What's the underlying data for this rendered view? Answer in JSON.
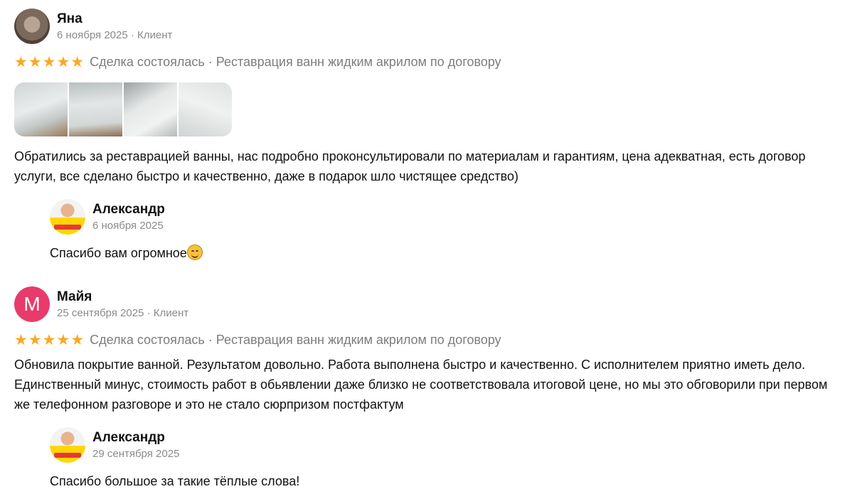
{
  "reviews": [
    {
      "author": "Яна",
      "date": "6 ноября 2025",
      "role": "Клиент",
      "rating": 5,
      "deal": "Сделка состоялась · Реставрация ванн жидким акрилом по договору",
      "photos": [
        "bathtub-photo-1",
        "bathtub-photo-2",
        "bathtub-photo-3",
        "bathtub-photo-4"
      ],
      "text": "Обратились за реставрацией ванны, нас подробно проконсультировали по материалам и гарантиям, цена адекватная, есть договор услуги, все сделано быстро и качественно, даже в подарок шло чистящее средство)",
      "reply": {
        "author": "Александр",
        "date": "6 ноября 2025",
        "text": "Спасибо вам огромное",
        "emoji": "smiling-face-emoji"
      }
    },
    {
      "author": "Майя",
      "avatar_letter": "М",
      "avatar_color": "#e83a6b",
      "date": "25 сентября 2025",
      "role": "Клиент",
      "rating": 5,
      "deal": "Сделка состоялась · Реставрация ванн жидким акрилом по договору",
      "text": "Обновила покрытие ванной. Результатом довольно. Работа выполнена быстро и качественно. С исполнителем приятно иметь дело. Единственный минус, стоимость работ в обьявлении даже близко не соответствовала итоговой цене, но мы это обговорили при первом же телефонном разговоре и это не стало сюрпризом постфактум",
      "reply": {
        "author": "Александр",
        "date": "29 сентября 2025",
        "text": "Спасибо большое за такие тёплые слова!"
      }
    }
  ],
  "separator": " · ",
  "star_glyph": "★",
  "star_color": "#f9a825"
}
